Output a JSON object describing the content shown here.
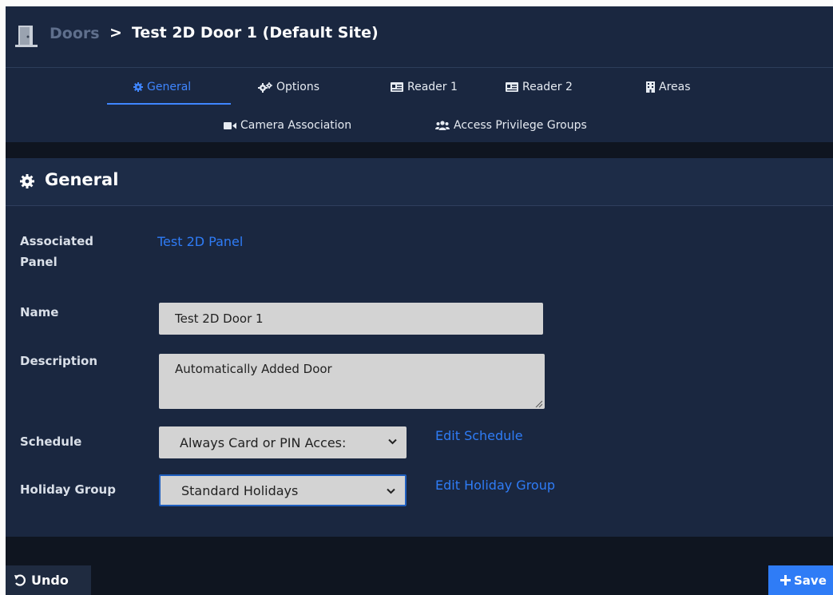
{
  "header": {
    "breadcrumb_parent": "Doors",
    "separator": ">",
    "title": "Test 2D Door 1 (Default Site)",
    "icon": "door-icon"
  },
  "tabs": [
    {
      "label": "General",
      "icon": "gear-icon",
      "active": true
    },
    {
      "label": "Options",
      "icon": "gears-icon",
      "active": false
    },
    {
      "label": "Reader 1",
      "icon": "card-reader-icon",
      "active": false
    },
    {
      "label": "Reader 2",
      "icon": "card-reader-icon",
      "active": false
    },
    {
      "label": "Areas",
      "icon": "building-icon",
      "active": false
    },
    {
      "label": "Camera Association",
      "icon": "video-camera-icon",
      "active": false
    },
    {
      "label": "Access Privilege Groups",
      "icon": "users-icon",
      "active": false
    }
  ],
  "panel": {
    "title": "General",
    "icon": "gear-icon"
  },
  "form": {
    "associated_panel_label": "Associated Panel",
    "associated_panel_value": "Test 2D Panel",
    "name_label": "Name",
    "name_value": "Test 2D Door 1",
    "description_label": "Description",
    "description_value": "Automatically Added Door",
    "schedule_label": "Schedule",
    "schedule_value": "Always Card or PIN Acces:",
    "edit_schedule_label": "Edit Schedule",
    "holiday_group_label": "Holiday Group",
    "holiday_group_value": "Standard Holidays",
    "edit_holiday_group_label": "Edit Holiday Group"
  },
  "footer": {
    "undo_label": "Undo",
    "save_label": "Save"
  },
  "colors": {
    "accent": "#2f7cf6",
    "background": "#1a2740",
    "active_tab": "#3f86ff"
  }
}
